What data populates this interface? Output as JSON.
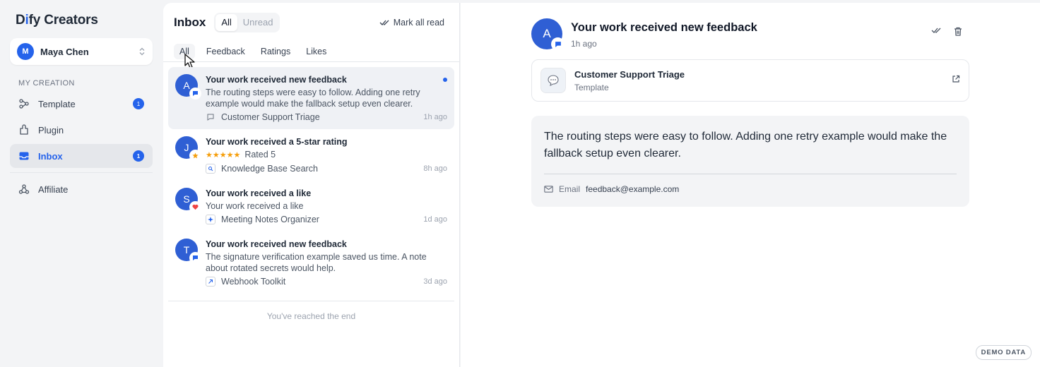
{
  "app": {
    "logo_prefix": "D",
    "logo_ai": "i",
    "logo_suffix": "fy Creators",
    "user": {
      "initial": "M",
      "name": "Maya Chen"
    }
  },
  "sidebar": {
    "section_label": "MY CREATION",
    "items": [
      {
        "label": "Template",
        "badge": "1",
        "icon": "template-icon",
        "active": false
      },
      {
        "label": "Plugin",
        "badge": "",
        "icon": "plugin-icon",
        "active": false
      },
      {
        "label": "Inbox",
        "badge": "1",
        "icon": "inbox-icon",
        "active": true
      }
    ],
    "affiliate_label": "Affiliate"
  },
  "inbox": {
    "title": "Inbox",
    "filters": [
      {
        "label": "All",
        "active": true
      },
      {
        "label": "Unread",
        "active": false
      }
    ],
    "mark_all_label": "Mark all read",
    "tabs": [
      {
        "label": "All",
        "active": true
      },
      {
        "label": "Feedback",
        "active": false
      },
      {
        "label": "Ratings",
        "active": false
      },
      {
        "label": "Likes",
        "active": false
      }
    ],
    "notifications": [
      {
        "initial": "A",
        "type_icon": "chat-icon",
        "title": "Your work received new feedback",
        "text": "The routing steps were easy to follow. Adding one retry example would make the fallback setup even clearer.",
        "source_icon": "chat-icon",
        "source": "Customer Support Triage",
        "time": "1h ago",
        "unread": true,
        "selected": true
      },
      {
        "initial": "J",
        "type_icon": "star-icon",
        "title": "Your work received a 5-star rating",
        "stars": "★★★★★",
        "rating_text": "Rated 5",
        "source_icon": "search-icon",
        "source": "Knowledge Base Search",
        "time": "8h ago",
        "unread": false,
        "selected": false
      },
      {
        "initial": "S",
        "type_icon": "heart-icon",
        "title": "Your work received a like",
        "text": "Your work received a like",
        "source_icon": "sparkle-icon",
        "source": "Meeting Notes Organizer",
        "time": "1d ago",
        "unread": false,
        "selected": false
      },
      {
        "initial": "T",
        "type_icon": "chat-icon",
        "title": "Your work received new feedback",
        "text": "The signature verification example saved us time. A note about rotated secrets would help.",
        "source_icon": "arrow-up-right-icon",
        "source": "Webhook Toolkit",
        "time": "3d ago",
        "unread": false,
        "selected": false
      }
    ],
    "end_text": "You've reached the end"
  },
  "detail": {
    "initial": "A",
    "title": "Your work received new feedback",
    "time": "1h ago",
    "card": {
      "title": "Customer Support Triage",
      "subtitle": "Template"
    },
    "message": "The routing steps were easy to follow. Adding one retry example would make the fallback setup even clearer.",
    "meta_label": "Email",
    "meta_value": "feedback@example.com"
  },
  "demo_tag": "DEMO DATA",
  "colors": {
    "accent": "#2563eb",
    "avatar": "#2f5fd4",
    "star": "#f59e0b",
    "heart": "#ef4444"
  }
}
